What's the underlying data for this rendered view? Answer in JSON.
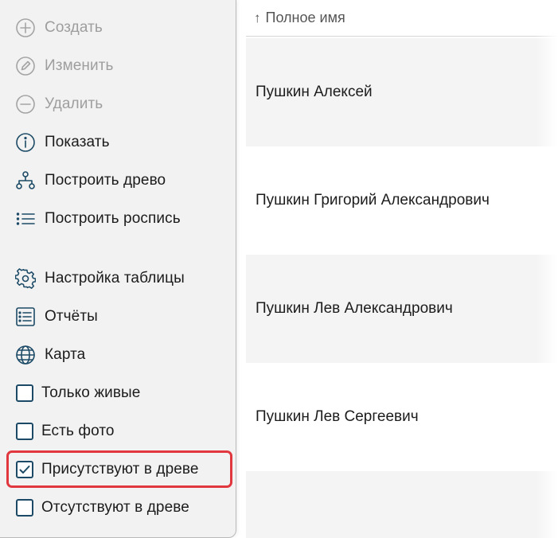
{
  "menu": {
    "items": [
      {
        "label": "Создать",
        "icon": "plus-circle-icon",
        "disabled": true
      },
      {
        "label": "Изменить",
        "icon": "pencil-circle-icon",
        "disabled": true
      },
      {
        "label": "Удалить",
        "icon": "minus-circle-icon",
        "disabled": true
      },
      {
        "label": "Показать",
        "icon": "info-circle-icon",
        "disabled": false
      },
      {
        "label": "Построить древо",
        "icon": "tree-icon",
        "disabled": false
      },
      {
        "label": "Построить роспись",
        "icon": "list-icon",
        "disabled": false
      },
      {
        "label": "Настройка таблицы",
        "icon": "gear-icon",
        "disabled": false
      },
      {
        "label": "Отчёты",
        "icon": "report-icon",
        "disabled": false
      },
      {
        "label": "Карта",
        "icon": "globe-icon",
        "disabled": false
      }
    ],
    "filters": [
      {
        "label": "Только живые",
        "checked": false
      },
      {
        "label": "Есть фото",
        "checked": false
      },
      {
        "label": "Присутствуют в древе",
        "checked": true
      },
      {
        "label": "Отсутствуют в древе",
        "checked": false
      }
    ]
  },
  "table": {
    "header": {
      "sort_arrow": "↑",
      "label": "Полное имя"
    },
    "rows": [
      "Пушкин Алексей",
      "Пушкин Григорий Александрович",
      "Пушкин Лев Александрович",
      "Пушкин Лев Сергеевич"
    ]
  },
  "colors": {
    "accent": "#1c4a66",
    "highlight": "#e0383e",
    "disabled": "#9e9e9e"
  }
}
